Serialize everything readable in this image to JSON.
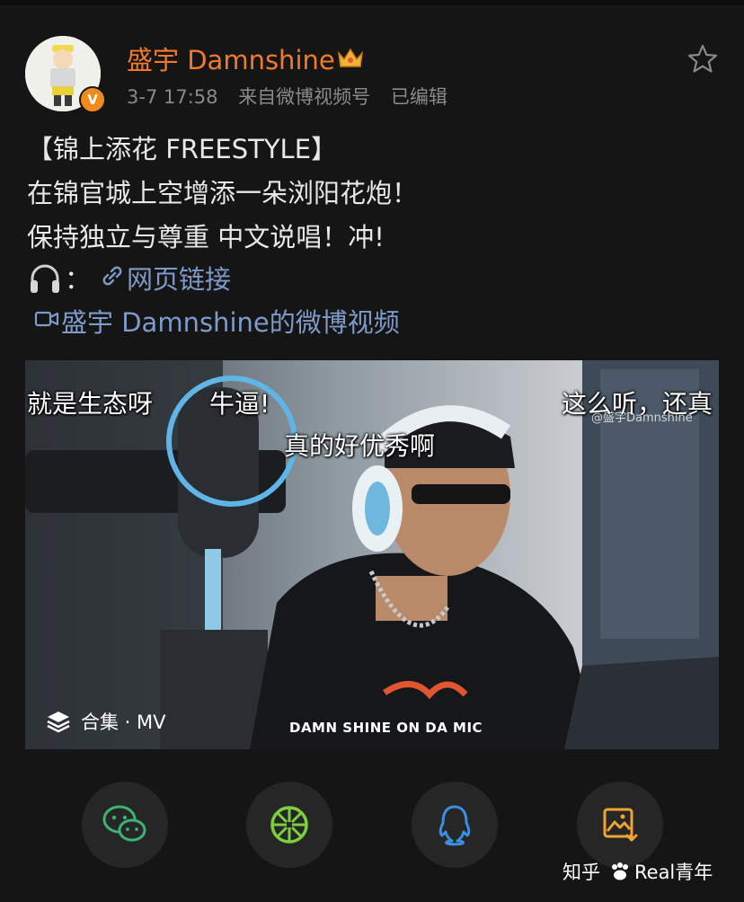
{
  "post": {
    "username": "盛宇 Damnshine",
    "time": "3-7 17:58",
    "source": "来自微博视频号",
    "edited": "已编辑",
    "lines": [
      "【锦上添花 FREESTYLE】",
      "在锦官城上空增添一朵浏阳花炮！",
      "保持独立与尊重  中文说唱！冲!"
    ],
    "music_colon": "：",
    "web_link": "网页链接",
    "video_link": "盛宇 Damnshine的微博视频"
  },
  "video": {
    "danmu": [
      "就是生态呀",
      "牛逼!",
      "真的好优秀啊",
      "这么听，还真"
    ],
    "watermark": "@盛宇Damnshine",
    "collection_label": "合集 · MV",
    "caption": "DAMN SHINE ON DA MIC"
  },
  "share": {
    "icons": [
      "wechat-icon",
      "moments-icon",
      "qq-icon",
      "save-image-icon"
    ],
    "colors": {
      "wechat": "#3cb371",
      "moments": "#7bd13c",
      "qq": "#3b8fe3",
      "save": "#f2a431"
    }
  },
  "footer": {
    "platform": "知乎",
    "account": "Real青年"
  },
  "colors": {
    "username": "#f07a2a",
    "link": "#7d9ac8",
    "meta": "#8a8a8a",
    "background": "#151515"
  }
}
